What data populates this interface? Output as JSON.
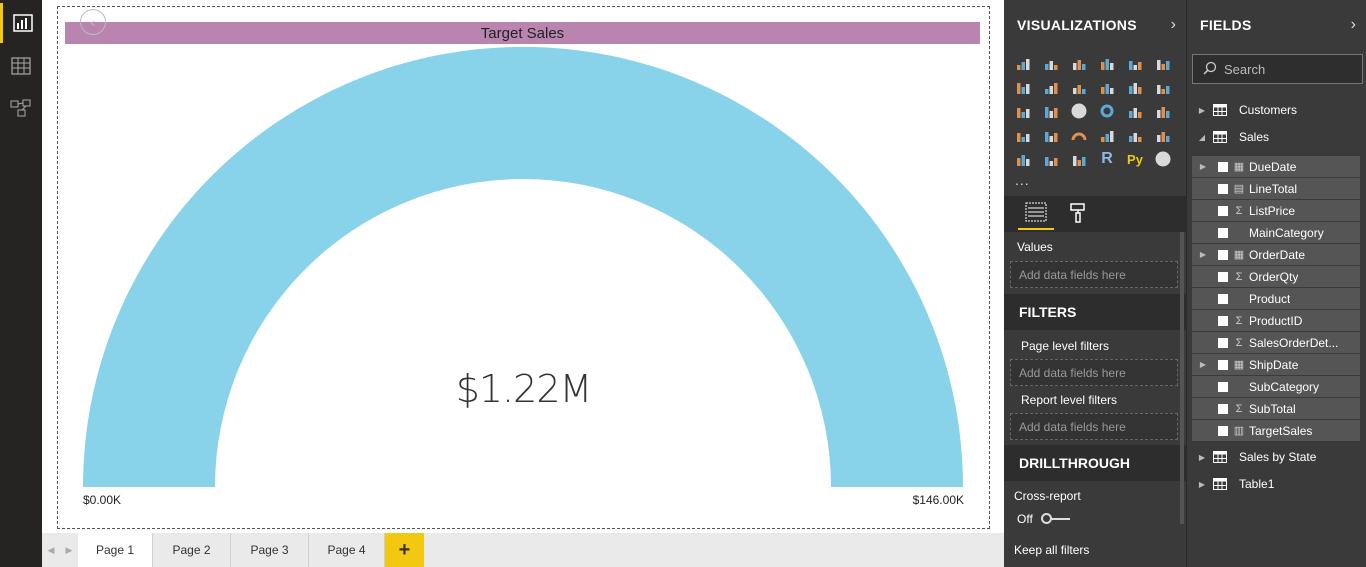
{
  "rail": {
    "items": [
      {
        "name": "report-view-icon",
        "active": true
      },
      {
        "name": "data-view-icon",
        "active": false
      },
      {
        "name": "relationships-view-icon",
        "active": false
      }
    ]
  },
  "visual": {
    "title": "Target Sales",
    "value_text": "$1.22M",
    "min_text": "$0.00K",
    "max_text": "$146.00K"
  },
  "chart_data": {
    "type": "gauge",
    "title": "Target Sales",
    "value": 1.22,
    "value_unit": "M",
    "min": 0,
    "max": 146,
    "range_unit": "K",
    "fill_fraction": 1.0,
    "colors": {
      "fill": "#89d3ea",
      "title_bar": "#b985b0"
    }
  },
  "pages": {
    "tabs": [
      "Page 1",
      "Page 2",
      "Page 3",
      "Page 4"
    ],
    "active": "Page 1",
    "add_label": "+"
  },
  "viz_pane": {
    "title": "VISUALIZATIONS",
    "more": "...",
    "values_label": "Values",
    "values_placeholder": "Add data fields here",
    "filters_title": "FILTERS",
    "page_filters": "Page level filters",
    "page_filters_placeholder": "Add data fields here",
    "report_filters": "Report level filters",
    "report_filters_placeholder": "Add data fields here",
    "drillthrough_title": "DRILLTHROUGH",
    "cross_report": "Cross-report",
    "toggle_state": "Off",
    "keep_filters": "Keep all filters",
    "r_label": "R",
    "py_label": "Py"
  },
  "fields_pane": {
    "title": "FIELDS",
    "search_placeholder": "Search",
    "tables": [
      {
        "name": "Customers"
      },
      {
        "name": "Sales"
      },
      {
        "name": "Sales by State"
      },
      {
        "name": "Table1"
      }
    ],
    "sales_fields": [
      {
        "name": "DueDate",
        "type": "date",
        "expandable": true
      },
      {
        "name": "LineTotal",
        "type": "calc"
      },
      {
        "name": "ListPrice",
        "type": "sigma"
      },
      {
        "name": "MainCategory",
        "type": "text"
      },
      {
        "name": "OrderDate",
        "type": "date",
        "expandable": true
      },
      {
        "name": "OrderQty",
        "type": "sigma"
      },
      {
        "name": "Product",
        "type": "text"
      },
      {
        "name": "ProductID",
        "type": "sigma"
      },
      {
        "name": "SalesOrderDet...",
        "type": "sigma"
      },
      {
        "name": "ShipDate",
        "type": "date",
        "expandable": true
      },
      {
        "name": "SubCategory",
        "type": "text"
      },
      {
        "name": "SubTotal",
        "type": "sigma"
      },
      {
        "name": "TargetSales",
        "type": "measure"
      }
    ]
  }
}
